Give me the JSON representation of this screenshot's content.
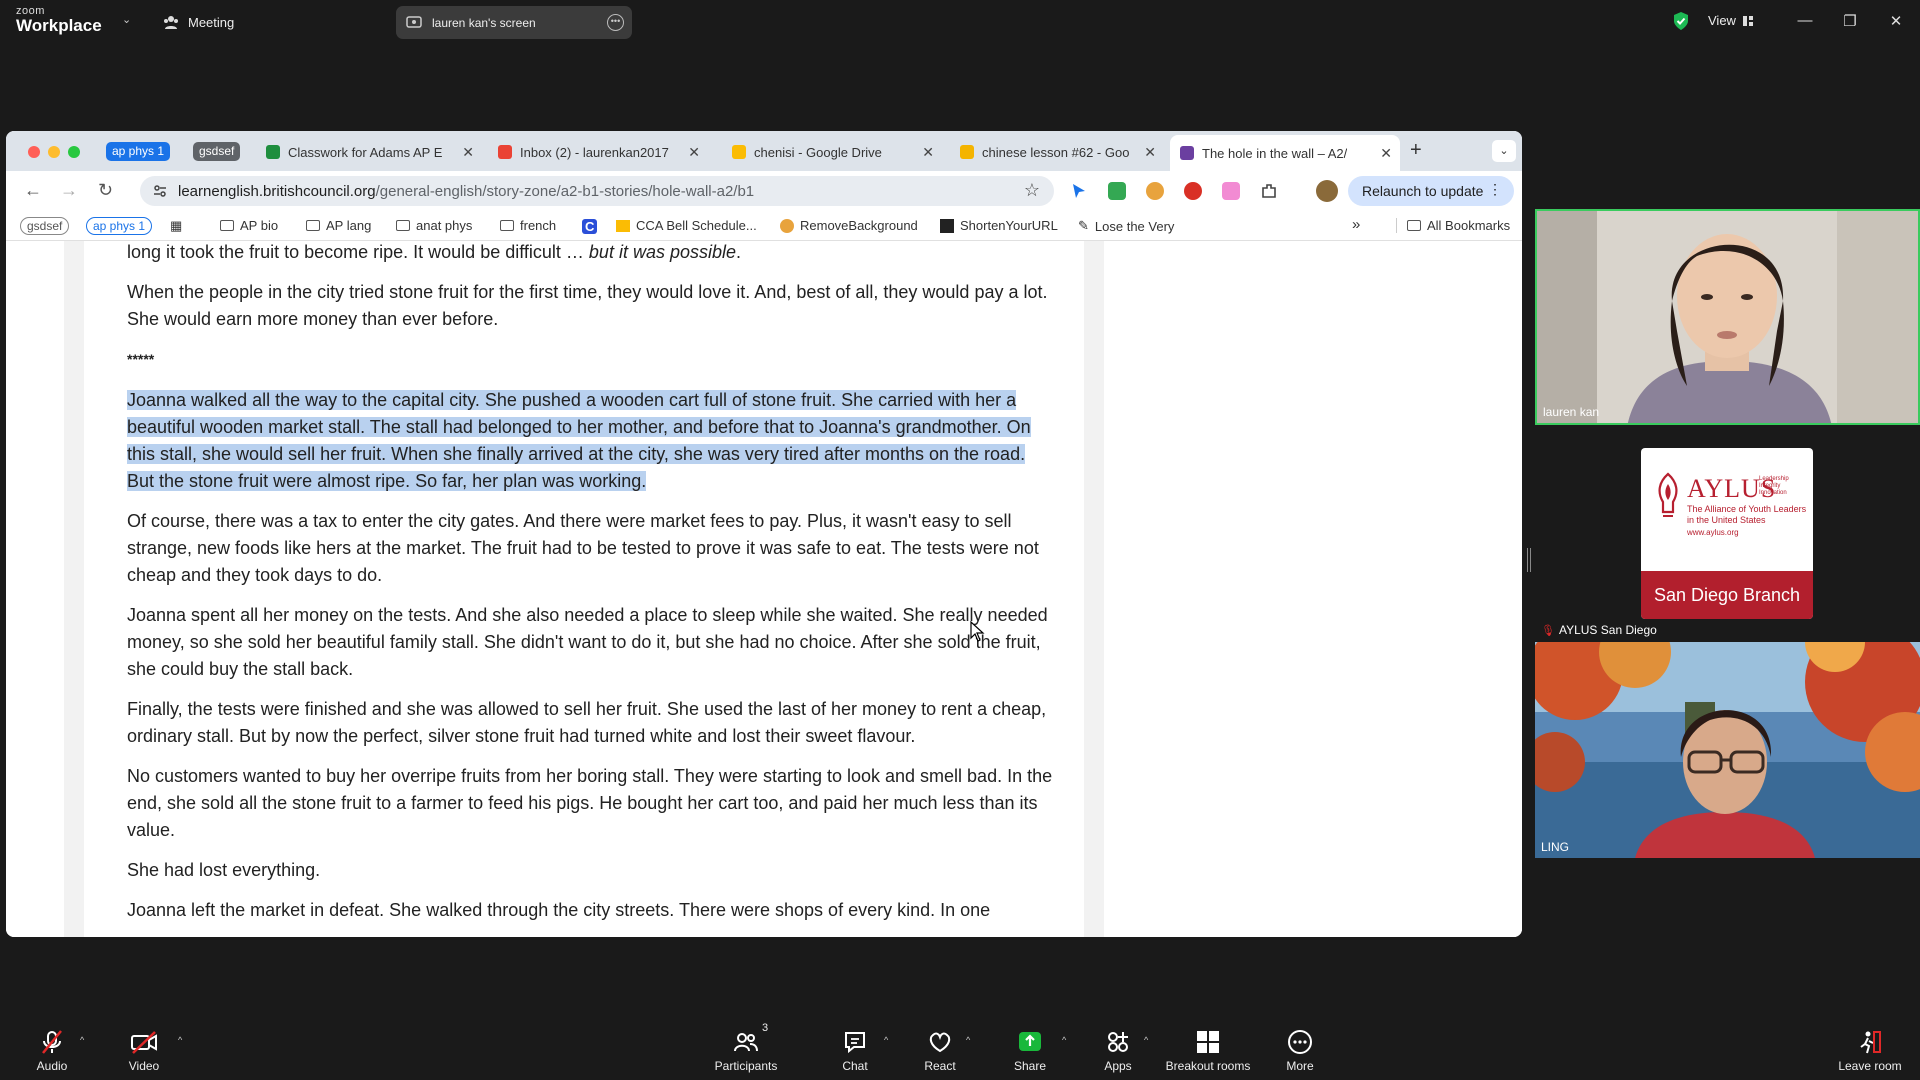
{
  "zoom": {
    "brand_small": "zoom",
    "brand_big": "Workplace",
    "meeting_label": "Meeting",
    "sharing_label": "lauren kan's screen",
    "view_label": "View"
  },
  "browser": {
    "tab_groups": [
      "ap phys 1",
      "gsdsef"
    ],
    "tabs": [
      {
        "title": "Classwork for Adams AP E",
        "icon_color": "#1e8e3e"
      },
      {
        "title": "Inbox (2) - laurenkan2017",
        "icon_color": "#ea4335"
      },
      {
        "title": "chenisi - Google Drive",
        "icon_color": "#fbbc04"
      },
      {
        "title": "chinese lesson #62 - Goo",
        "icon_color": "#f4b400"
      },
      {
        "title": "The hole in the wall – A2/",
        "icon_color": "#6b3fa0"
      }
    ],
    "url_host": "learnenglish.britishcouncil.org",
    "url_path": "/general-english/story-zone/a2-b1-stories/hole-wall-a2/b1",
    "relaunch_label": "Relaunch to update",
    "bookmarks": {
      "groups": [
        "gsdsef",
        "ap phys 1"
      ],
      "items": [
        "AP bio",
        "AP lang",
        "anat phys",
        "french",
        "CCA Bell Schedule...",
        "RemoveBackground",
        "ShortenYourURL",
        "Lose the Very"
      ],
      "overflow": "»",
      "all": "All Bookmarks"
    }
  },
  "article": {
    "p0_a": "long it took the fruit to become ripe. It would be difficult … ",
    "p0_b": "but it was possible",
    "p0_c": ".",
    "p1": "When the people in the city tried stone fruit for the first time, they would love it. And, best of all, they would pay a lot. She would earn more money than ever before.",
    "sep": "*****",
    "p2": "Joanna walked all the way to the capital city. She pushed a wooden cart full of stone fruit. She carried with her a beautiful wooden market stall. The stall had belonged to her mother, and before that to Joanna's grandmother. On this stall, she would sell her fruit. When she finally arrived at the city, she was very tired after months on the road. But the stone fruit were almost ripe. So far, her plan was working.",
    "p3": "Of course, there was a tax to enter the city gates. And there were market fees to pay. Plus, it wasn't easy to sell strange, new foods like hers at the market. The fruit had to be tested to prove it was safe to eat. The tests were not cheap and they took days to do.",
    "p4": "Joanna spent all her money on the tests. And she also needed a place to sleep while she waited. She really needed money, so she sold her beautiful family stall. She didn't want to do it, but she had no choice. After she sold the fruit, she could buy the stall back.",
    "p5": "Finally, the tests were finished and she was allowed to sell her fruit. She used the last of her money to rent a cheap, ordinary stall. But by now the perfect, silver stone fruit had turned white and lost their sweet flavour.",
    "p6": "No customers wanted to buy her overripe fruits from her boring stall. They were starting to look and smell bad. In the end, she sold all the stone fruit to a farmer to feed his pigs. He bought her cart too, and paid her much less than its value.",
    "p7": "She had lost everything.",
    "p8": "Joanna left the market in defeat. She walked through the city streets. There were shops of every kind. In one"
  },
  "participants": [
    {
      "name": "lauren kan"
    },
    {
      "name": "AYLUS San Diego",
      "logo_brand": "AYLUS",
      "logo_sub": "The Alliance of Youth Leaders in the United States",
      "logo_url": "www.aylus.org",
      "logo_tagline": "Leadership Integrity Innovation",
      "logo_banner": "San Diego Branch"
    },
    {
      "name": "LING"
    }
  ],
  "toolbar": {
    "audio": "Audio",
    "video": "Video",
    "participants": "Participants",
    "participants_count": "3",
    "chat": "Chat",
    "react": "React",
    "share": "Share",
    "apps": "Apps",
    "breakout": "Breakout rooms",
    "more": "More",
    "leave": "Leave room"
  },
  "icons": [
    "zoom-logo",
    "meeting-icon",
    "screen-share-icon",
    "shield-icon",
    "mic-muted-icon",
    "video-off-icon",
    "participants-icon",
    "chat-icon",
    "react-icon",
    "share-icon",
    "apps-icon",
    "breakout-icon",
    "more-icon",
    "leave-icon"
  ],
  "colors": {
    "accent_green": "#3acb5e",
    "share_green": "#19b83b",
    "selection": "#b9d1ef",
    "aylus_red": "#b21f2d"
  }
}
